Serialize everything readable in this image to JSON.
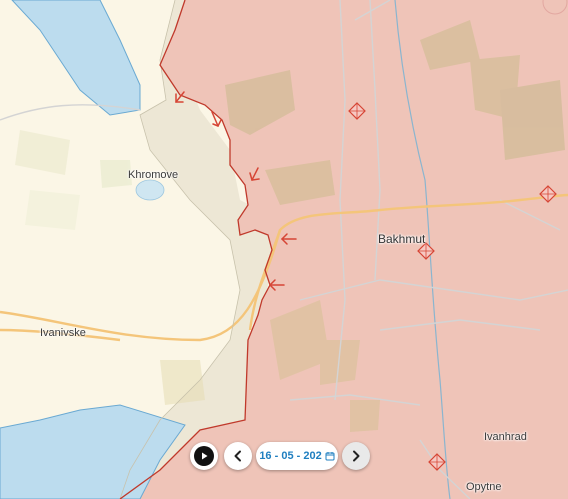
{
  "places": {
    "khromove": "Khromove",
    "bakhmut": "Bakhmut",
    "ivanivske": "Ivanivske",
    "ivanhrad": "Ivanhrad",
    "opytne": "Opytne"
  },
  "timeline": {
    "date_value": "16 - 05 - 202",
    "play_icon": "play-icon",
    "prev_icon": "chevron-left-icon",
    "next_icon": "chevron-right-icon",
    "calendar_icon": "calendar-icon"
  },
  "legend_colors": {
    "occupied_area": "#efc4b8",
    "contested_area": "#ede7d5",
    "ukraine_controlled": "#fbf6e6",
    "water": "#bcdcee",
    "front_line": "#c0392b",
    "main_road": "#f4c57a"
  }
}
